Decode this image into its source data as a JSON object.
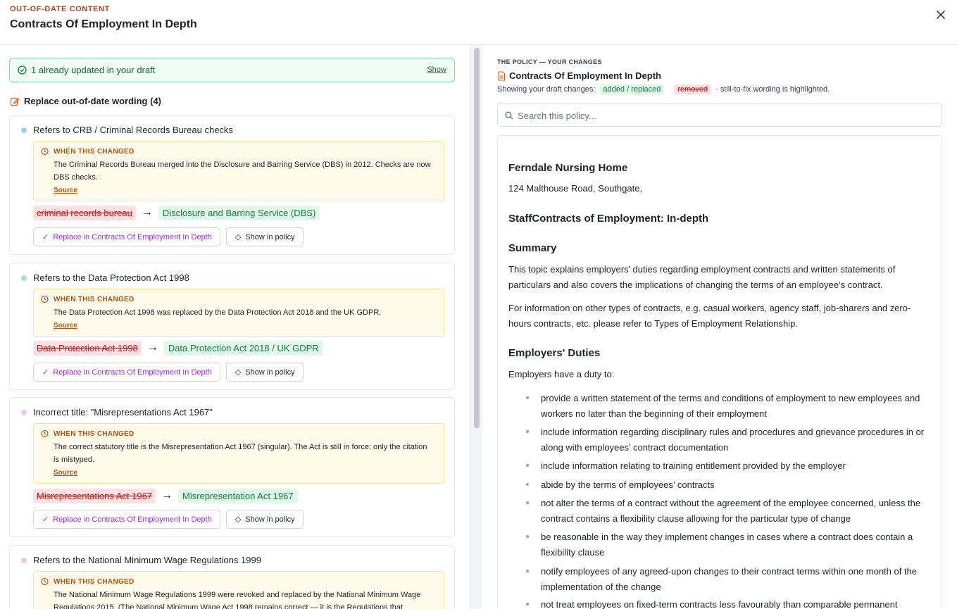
{
  "header": {
    "eyebrow": "OUT-OF-DATE CONTENT",
    "title": "Contracts Of Employment In Depth"
  },
  "left": {
    "updated": {
      "label": "1 already updated in your draft",
      "show": "Show"
    },
    "section_title": "Replace out-of-date wording (4)",
    "cards": [
      {
        "title": "Refers to CRB / Criminal Records Bureau checks",
        "dot_color": "#93d4f0",
        "why_label": "WHEN THIS CHANGED",
        "why_text": "The Criminal Records Bureau merged into the Disclosure and Barring Service (DBS) in 2012. Checks are now DBS checks.",
        "source": "Source",
        "old": "criminal records bureau",
        "new": "Disclosure and Barring Service (DBS)",
        "replace_label": "Replace in Contracts Of Employment In Depth",
        "show_label": "Show in policy"
      },
      {
        "title": "Refers to the Data Protection Act 1998",
        "dot_color": "#a7e3bd",
        "why_label": "WHEN THIS CHANGED",
        "why_text": "The Data Protection Act 1998 was replaced by the Data Protection Act 2018 and the UK GDPR.",
        "source": "Source",
        "old": "Data Protection Act 1998",
        "new": "Data Protection Act 2018 / UK GDPR",
        "replace_label": "Replace in Contracts Of Employment In Depth",
        "show_label": "Show in policy"
      },
      {
        "title": "Incorrect title: \"Misrepresentations Act 1967\"",
        "dot_color": "#e6c9f5",
        "why_label": "WHEN THIS CHANGED",
        "why_text": "The correct statutory title is the Misrepresentation Act 1967 (singular). The Act is still in force; only the citation is mistyped.",
        "source": "Source",
        "old": "Misrepresentations Act 1967",
        "new": "Misrepresentation Act 1967",
        "replace_label": "Replace in Contracts Of Employment In Depth",
        "show_label": "Show in policy"
      },
      {
        "title": "Refers to the National Minimum Wage Regulations 1999",
        "dot_color": "#f7c6d6",
        "why_label": "WHEN THIS CHANGED",
        "why_text": "The National Minimum Wage Regulations 1999 were revoked and replaced by the National Minimum Wage Regulations 2015. (The National Minimum Wage Act 1998 remains correct — it is the Regulations that"
      }
    ]
  },
  "right": {
    "eyebrow": "THE POLICY — YOUR CHANGES",
    "title": "Contracts Of Employment In Depth",
    "legend_prefix": "Showing your draft changes:",
    "legend_added": "added / replaced",
    "legend_removed": "removed",
    "legend_suffix": "· still-to-fix wording is highlighted.",
    "search_placeholder": "Search this policy...",
    "doc": {
      "org": "Ferndale Nursing Home",
      "address": "124 Malthouse Road, Southgate,",
      "heading": "StaffContracts of Employment: In-depth",
      "summary_h": "Summary",
      "summary_p1": "This topic explains employers’ duties regarding employment contracts and written statements of particulars and also covers the implications of changing the terms of an employee’s contract.",
      "summary_p2": "For information on other types of contracts, e.g. casual workers, agency staff, job-sharers and zero-hours contracts, etc. please refer to Types of Employment Relationship.",
      "duties_h": "Employers' Duties",
      "duties_intro": "Employers have a duty to:",
      "duties": [
        "provide a written statement of the terms and conditions of employment to new employees and workers no later than the beginning of their employment",
        "include information regarding disciplinary rules and procedures and grievance procedures in or along with employees’ contract documentation",
        "include information relating to training entitlement provided by the employer",
        "abide by the terms of employees’ contracts",
        "not alter the terms of a contract without the agreement of the employee concerned, unless the contract contains a flexibility clause allowing for the particular type of change",
        "be reasonable in the way they implement changes in cases where a contract does contain a flexibility clause",
        "notify employees of any agreed-upon changes to their contract terms within one month of the implementation of the change",
        "not treat employees on fixed-term contracts less favourably than comparable permanent"
      ]
    }
  }
}
